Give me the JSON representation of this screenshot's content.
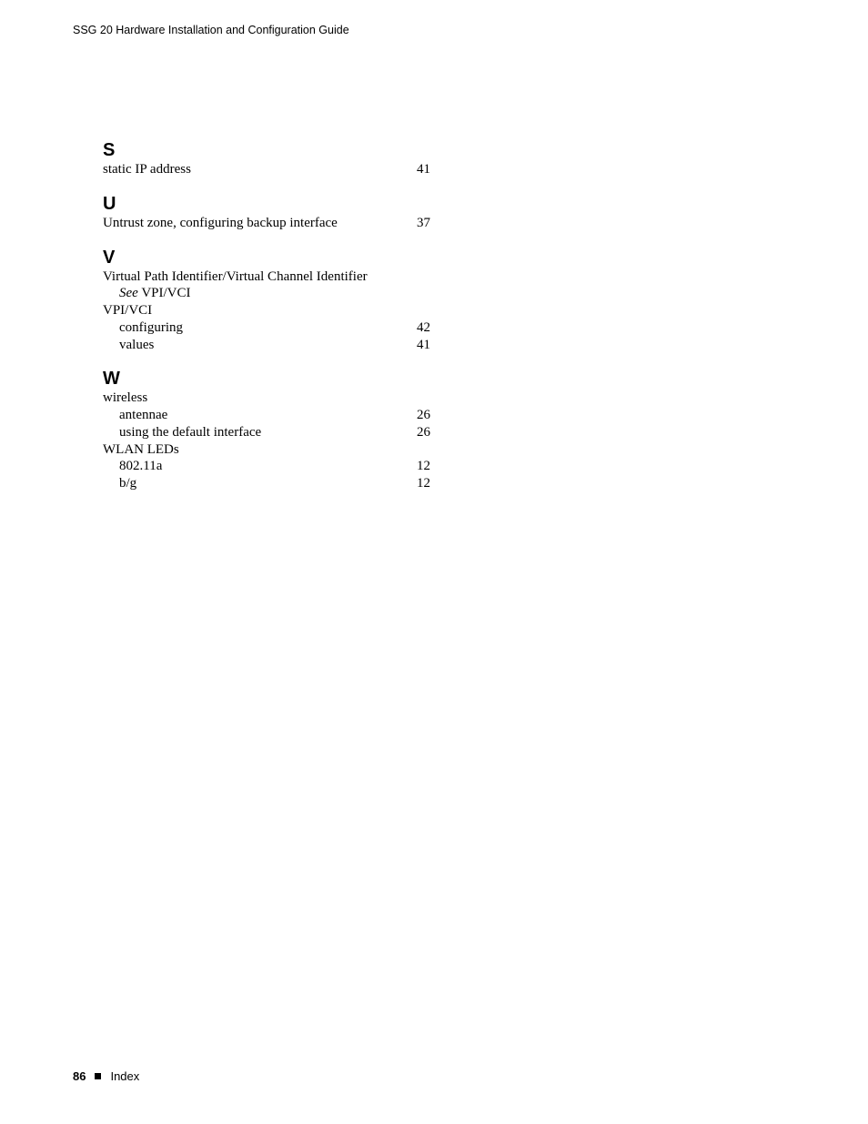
{
  "header": {
    "running_title": "SSG 20 Hardware Installation and Configuration Guide"
  },
  "index": {
    "sections": [
      {
        "letter": "S",
        "entries": [
          {
            "type": "leaf",
            "indent": 0,
            "label": "static IP address",
            "page": "41"
          }
        ]
      },
      {
        "letter": "U",
        "entries": [
          {
            "type": "leaf",
            "indent": 0,
            "label": "Untrust zone, configuring backup interface",
            "page": "37"
          }
        ]
      },
      {
        "letter": "V",
        "entries": [
          {
            "type": "plain",
            "indent": 0,
            "label": "Virtual Path Identifier/Virtual Channel Identifier"
          },
          {
            "type": "see",
            "indent": 1,
            "see_prefix": "See",
            "see_target": "VPI/VCI"
          },
          {
            "type": "plain",
            "indent": 0,
            "label": "VPI/VCI"
          },
          {
            "type": "leaf",
            "indent": 1,
            "label": "configuring",
            "page": "42"
          },
          {
            "type": "leaf",
            "indent": 1,
            "label": "values",
            "page": "41"
          }
        ]
      },
      {
        "letter": "W",
        "entries": [
          {
            "type": "plain",
            "indent": 0,
            "label": "wireless"
          },
          {
            "type": "leaf",
            "indent": 1,
            "label": "antennae",
            "page": "26"
          },
          {
            "type": "leaf",
            "indent": 1,
            "label": "using the default interface",
            "page": "26"
          },
          {
            "type": "plain",
            "indent": 0,
            "label": "WLAN LEDs"
          },
          {
            "type": "leaf",
            "indent": 1,
            "label": "802.11a",
            "page": "12"
          },
          {
            "type": "leaf",
            "indent": 1,
            "label": "b/g",
            "page": "12"
          }
        ]
      }
    ]
  },
  "footer": {
    "page_number": "86",
    "section_label": "Index"
  }
}
